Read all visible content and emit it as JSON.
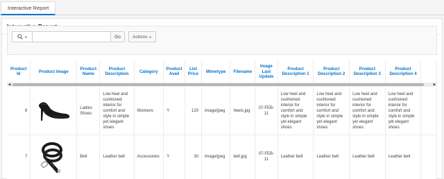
{
  "tab": {
    "label": "Interactive Report"
  },
  "region": {
    "title": "Interactive Report"
  },
  "toolbar": {
    "search_icon": "search-icon",
    "search_value": "",
    "go_label": "Go",
    "actions_label": "Actions"
  },
  "table": {
    "headers": {
      "product_id": "Product Id",
      "product_image": "Product Image",
      "product_name": "Product Name",
      "product_description": "Product Description",
      "category": "Category",
      "product_avail": "Product Avail",
      "list_price": "List Price",
      "mimetype": "Mimetype",
      "filename": "Filename",
      "image_last_update": "Image Last Update",
      "desc1": "Product Description 1",
      "desc2": "Product Description 2",
      "desc3": "Product Description 3",
      "desc4": "Product Description 4"
    },
    "rows": [
      {
        "product_id": "6",
        "image_icon": "shoe-image",
        "product_name": "Ladies Shoes",
        "product_description": "Low heel and cushioned interior for comfort and style in simple yet elegant shoes",
        "category": "Womens",
        "product_avail": "Y",
        "list_price": "120",
        "mimetype": "image/jpeg",
        "filename": "heels.jpg",
        "image_last_update": "07-FEB-11",
        "desc1": "Low heel and cushioned interior for comfort and style in simple yet elegant shoes",
        "desc2": "Low heel and cushioned interior for comfort and style in simple yet elegant shoes",
        "desc3": "Low heel and cushioned interior for comfort and style in simple yet elegant shoes",
        "desc4": "Low heel and cushioned interior for comfort and style in simple yet elegant shoes"
      },
      {
        "product_id": "7",
        "image_icon": "belt-image",
        "product_name": "Belt",
        "product_description": "Leather belt",
        "category": "Accessories",
        "product_avail": "Y",
        "list_price": "30",
        "mimetype": "image/jpeg",
        "filename": "belt.jpg",
        "image_last_update": "07-FEB-11",
        "desc1": "Leather belt",
        "desc2": "Leather belt",
        "desc3": "Leather belt",
        "desc4": "Leather belt"
      }
    ]
  }
}
